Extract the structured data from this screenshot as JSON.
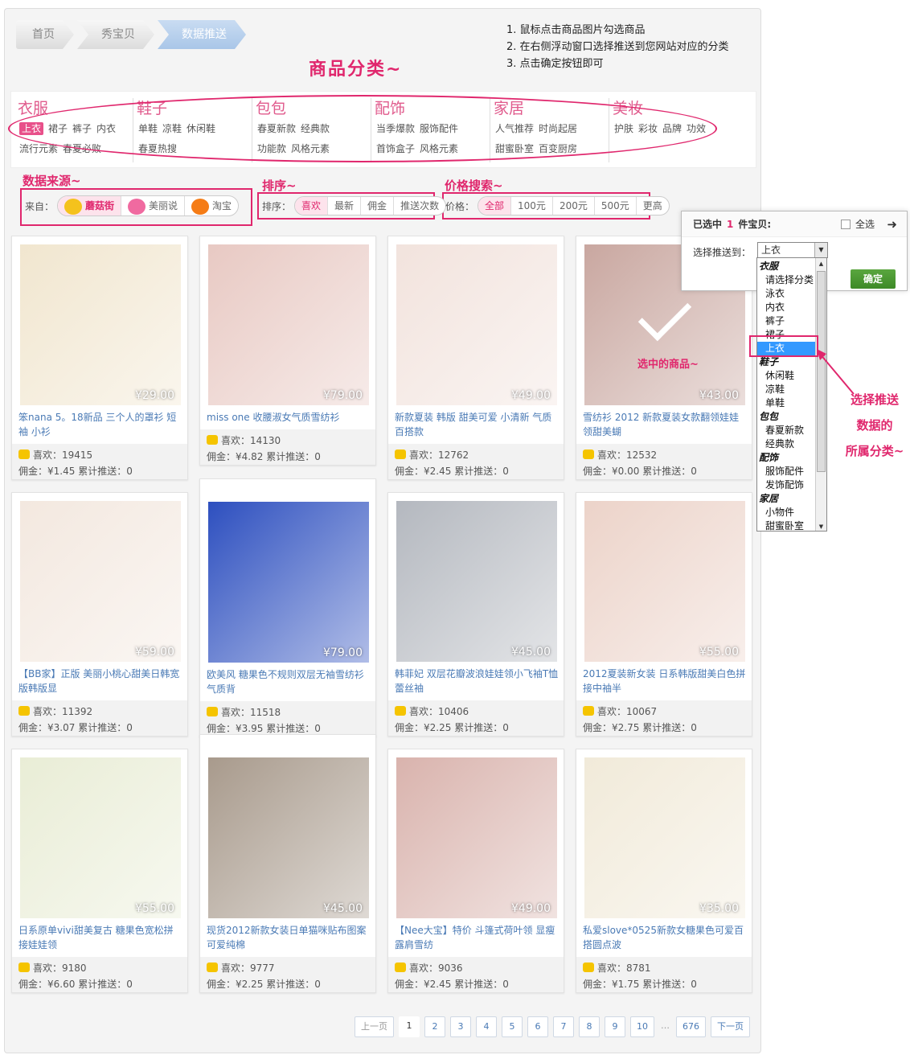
{
  "breadcrumb": [
    "首页",
    "秀宝贝",
    "数据推送"
  ],
  "steps": [
    "1.  鼠标点击商品图片勾选商品",
    "2.  在右侧浮动窗口选择推送到您网站对应的分类",
    "3.  点击确定按钮即可"
  ],
  "annotations": {
    "categories": "商品分类~",
    "source": "数据来源~",
    "sort": "排序~",
    "price": "价格搜索~",
    "selected": "选中的商品~",
    "side": [
      "选择推送",
      "数据的",
      "所属分类~"
    ]
  },
  "categories": [
    {
      "title": "衣服",
      "rows": [
        [
          "上衣",
          "裙子",
          "裤子",
          "内衣"
        ],
        [
          "流行元素",
          "春夏必败"
        ]
      ]
    },
    {
      "title": "鞋子",
      "rows": [
        [
          "单鞋",
          "凉鞋",
          "休闲鞋"
        ],
        [
          "春夏热搜"
        ]
      ]
    },
    {
      "title": "包包",
      "rows": [
        [
          "春夏新款",
          "经典款"
        ],
        [
          "功能款",
          "风格元素"
        ]
      ]
    },
    {
      "title": "配饰",
      "rows": [
        [
          "当季爆款",
          "服饰配件"
        ],
        [
          "首饰盒子",
          "风格元素"
        ]
      ]
    },
    {
      "title": "家居",
      "rows": [
        [
          "人气推荐",
          "时尚起居"
        ],
        [
          "甜蜜卧室",
          "百变厨房"
        ]
      ]
    },
    {
      "title": "美妆",
      "rows": [
        [
          "护肤",
          "彩妆",
          "品牌",
          "功效"
        ],
        []
      ]
    }
  ],
  "source": {
    "label": "来自：",
    "options": [
      "蘑菇街",
      "美丽说",
      "淘宝"
    ]
  },
  "sort": {
    "label": "排序：",
    "options": [
      "喜欢",
      "最新",
      "佣金",
      "推送次数"
    ]
  },
  "price_filter": {
    "label": "价格：",
    "options": [
      "全部",
      "100元",
      "200元",
      "500元",
      "更高"
    ]
  },
  "labels": {
    "likes": "喜欢：",
    "commission": "佣金：",
    "pushed": "累计推送："
  },
  "products": [
    {
      "title": "笨nana 5。18新品 三个人的罩衫 短袖 小衫",
      "price": "¥29.00",
      "likes": "19415",
      "commission": "¥1.45",
      "pushed": "0",
      "color": "#f1e6cf"
    },
    {
      "title": "miss one 收腰淑女气质雪纺衫",
      "price": "¥79.00",
      "likes": "14130",
      "commission": "¥4.82",
      "pushed": "0",
      "color": "#e8c9c3"
    },
    {
      "title": "新款夏装 韩版 甜美可爱 小清新 气质百搭款",
      "price": "¥49.00",
      "likes": "12762",
      "commission": "¥2.45",
      "pushed": "0",
      "color": "#f2e3dd"
    },
    {
      "title": "雪纺衫 2012 新款夏装女款翻领娃娃领甜美蝴",
      "price": "¥43.00",
      "likes": "12532",
      "commission": "¥0.00",
      "pushed": "0",
      "color": "#c9a7a0"
    },
    {
      "title": "【BB家】正版 美丽小桃心甜美日韩宽版韩版显",
      "price": "¥59.00",
      "likes": "11392",
      "commission": "¥3.07",
      "pushed": "0",
      "color": "#f3e8df"
    },
    {
      "title": "欧美风 糖果色不规则双层无袖雪纺衫气质背",
      "price": "¥79.00",
      "likes": "11518",
      "commission": "¥3.95",
      "pushed": "0",
      "color": "#2d4fbf"
    },
    {
      "title": "韩菲妃 双层花瓣波浪娃娃领小飞袖T恤 蕾丝袖",
      "price": "¥45.00",
      "likes": "10406",
      "commission": "¥2.25",
      "pushed": "0",
      "color": "#b4b8bf"
    },
    {
      "title": "2012夏装新女装 日系韩版甜美白色拼接中袖半",
      "price": "¥55.00",
      "likes": "10067",
      "commission": "¥2.75",
      "pushed": "0",
      "color": "#ecd3c9"
    },
    {
      "title": "日系原单vivi甜美复古 糖果色宽松拼接娃娃领",
      "price": "¥55.00",
      "likes": "9180",
      "commission": "¥6.60",
      "pushed": "0",
      "color": "#e9edd6"
    },
    {
      "title": "现货2012新款女装日单猫咪贴布图案可爱纯棉",
      "price": "¥45.00",
      "likes": "9777",
      "commission": "¥2.25",
      "pushed": "0",
      "color": "#a89a8c"
    },
    {
      "title": "【Nee大宝】特价 斗篷式荷叶领 显瘦露肩雪纺",
      "price": "¥49.00",
      "likes": "9036",
      "commission": "¥2.45",
      "pushed": "0",
      "color": "#d9b3ad"
    },
    {
      "title": "私爱slove*0525新款女糖果色可爱百搭圆点波",
      "price": "¥35.00",
      "likes": "8781",
      "commission": "¥1.75",
      "pushed": "0",
      "color": "#f1ead9"
    }
  ],
  "push_window": {
    "selected_prefix": "已选中",
    "selected_count": "1",
    "selected_suffix": "件宝贝:",
    "select_all": "全选",
    "push_to": "选择推送到：",
    "current": "上衣",
    "confirm": "确定"
  },
  "dropdown": [
    {
      "text": "衣服",
      "group": true
    },
    {
      "text": "请选择分类"
    },
    {
      "text": "泳衣"
    },
    {
      "text": "内衣"
    },
    {
      "text": "裤子"
    },
    {
      "text": "裙子"
    },
    {
      "text": "上衣",
      "selected": true
    },
    {
      "text": "鞋子",
      "group": true
    },
    {
      "text": "休闲鞋"
    },
    {
      "text": "凉鞋"
    },
    {
      "text": "单鞋"
    },
    {
      "text": "包包",
      "group": true
    },
    {
      "text": "春夏新款"
    },
    {
      "text": "经典款"
    },
    {
      "text": "配饰",
      "group": true
    },
    {
      "text": "服饰配件"
    },
    {
      "text": "发饰配饰"
    },
    {
      "text": "家居",
      "group": true
    },
    {
      "text": "小物件"
    },
    {
      "text": "甜蜜卧室"
    }
  ],
  "pagination": {
    "prev": "上一页",
    "pages": [
      "1",
      "2",
      "3",
      "4",
      "5",
      "6",
      "7",
      "8",
      "9",
      "10"
    ],
    "ellipsis": "…",
    "last": "676",
    "next": "下一页",
    "current": "1"
  },
  "colors": {
    "accent": "#e0276d",
    "link": "#4a7ab5",
    "confirm": "#4a9a33"
  }
}
